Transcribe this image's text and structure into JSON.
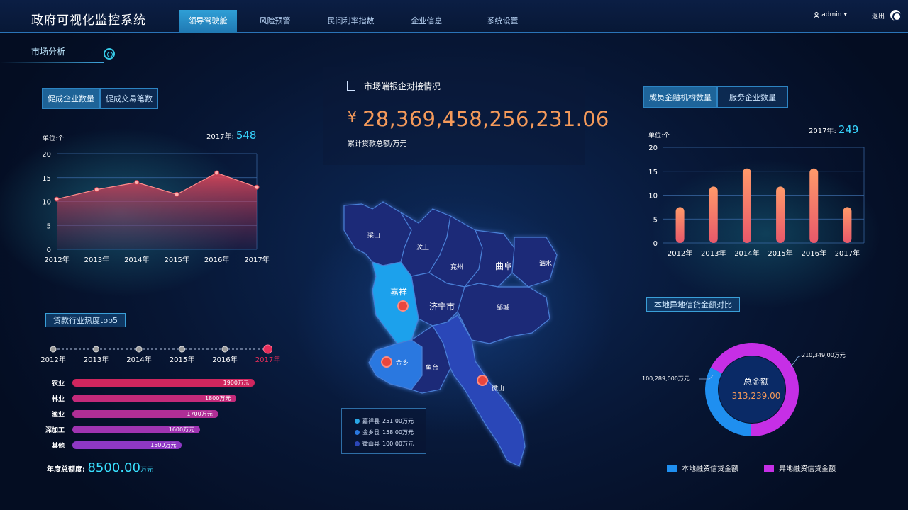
{
  "header": {
    "title": "政府可视化监控系统",
    "nav": [
      "领导驾驶舱",
      "风险预警",
      "民间利率指数",
      "企业信息",
      "系统设置"
    ],
    "user": "admin",
    "logout": "退出"
  },
  "section": {
    "title": "市场分析"
  },
  "left_chart": {
    "tabs": [
      "促成企业数量",
      "促成交易笔数"
    ],
    "unit": "单位:个",
    "year_label": "2017年:",
    "year_value": "548"
  },
  "top5": {
    "title": "贷款行业热度top5",
    "timeline": [
      "2012年",
      "2013年",
      "2014年",
      "2015年",
      "2016年",
      "2017年"
    ],
    "items": [
      {
        "label": "农业",
        "value": "1900万元"
      },
      {
        "label": "林业",
        "value": "1800万元"
      },
      {
        "label": "渔业",
        "value": "1700万元"
      },
      {
        "label": "深加工",
        "value": "1600万元"
      },
      {
        "label": "其他",
        "value": "1500万元"
      }
    ],
    "total_label": "年度总额度:",
    "total_value": "8500.00",
    "total_unit": "万元"
  },
  "center": {
    "title": "市场端银企对接情况",
    "currency": "¥",
    "amount": "28,369,458,256,231.06",
    "label": "累计贷款总额/万元",
    "map_regions": [
      "梁山",
      "汶上",
      "兖州",
      "曲阜",
      "泗水",
      "嘉祥",
      "济宁市",
      "邹城",
      "金乡",
      "鱼台",
      "微山"
    ],
    "legend": [
      {
        "name": "嘉祥县",
        "value": "251.00万元",
        "color": "#2aa7e6"
      },
      {
        "name": "金乡县",
        "value": "158.00万元",
        "color": "#2a78e0"
      },
      {
        "name": "微山县",
        "value": "100.00万元",
        "color": "#2b46b8"
      }
    ]
  },
  "right_chart": {
    "tabs": [
      "成员金融机构数量",
      "服务企业数量"
    ],
    "unit": "单位:个",
    "year_label": "2017年:",
    "year_value": "249"
  },
  "donut": {
    "title": "本地异地信贷金额对比",
    "center_title": "总金额",
    "center_value": "313,239,00",
    "local_label": "100,289,000",
    "remote_label": "210,349,00",
    "unit": "万元",
    "legend": [
      "本地融资信贷金额",
      "异地融资信贷金额"
    ],
    "colors": {
      "local": "#1f8ff0",
      "remote": "#c62fe6"
    }
  },
  "chart_data": [
    {
      "type": "area",
      "categories": [
        "2012年",
        "2013年",
        "2014年",
        "2015年",
        "2016年",
        "2017年"
      ],
      "values": [
        10.5,
        12.5,
        14,
        11.5,
        16,
        13
      ],
      "ylim": [
        0,
        20
      ],
      "yticks": [
        0,
        5,
        10,
        15,
        20
      ]
    },
    {
      "type": "bar",
      "categories": [
        "2012年",
        "2013年",
        "2014年",
        "2015年",
        "2016年",
        "2017年"
      ],
      "values": [
        7.5,
        11.8,
        15.6,
        11.8,
        15.6,
        7.5
      ],
      "ylim": [
        0,
        20
      ],
      "yticks": [
        0,
        5,
        10,
        15,
        20
      ]
    },
    {
      "type": "bar",
      "categories": [
        "农业",
        "林业",
        "渔业",
        "深加工",
        "其他"
      ],
      "values": [
        1900,
        1800,
        1700,
        1600,
        1500
      ]
    },
    {
      "type": "pie",
      "categories": [
        "本地融资信贷金额",
        "异地融资信贷金额"
      ],
      "values": [
        100289000,
        210349000
      ]
    }
  ]
}
